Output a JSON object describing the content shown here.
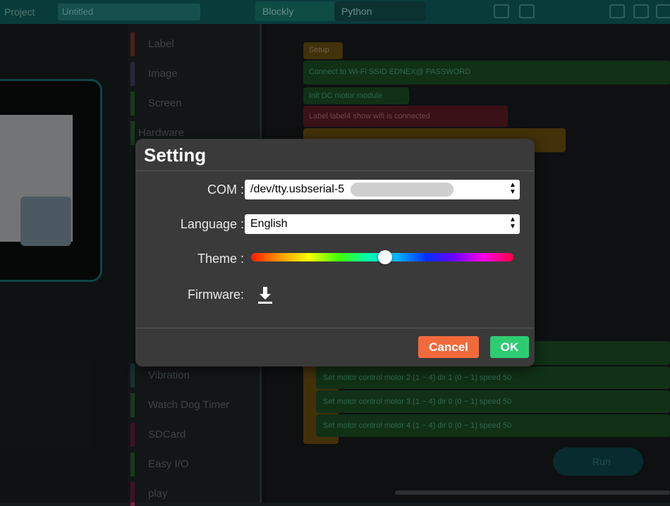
{
  "topbar": {
    "project_label": "Project",
    "project_name": "Untitled",
    "tabs": [
      {
        "label": "Blockly"
      },
      {
        "label": "Python"
      }
    ]
  },
  "categories": [
    {
      "label": "Label",
      "color": "#8a3a2a"
    },
    {
      "label": "Image",
      "color": "#4a4a6a"
    },
    {
      "label": "Screen",
      "color": "#2f6a2f"
    },
    {
      "label": "Hardware",
      "color": "#2f6a2f"
    },
    {
      "label": "Vibration",
      "color": "#2a5a5a"
    },
    {
      "label": "Watch Dog Timer",
      "color": "#2f6a2f"
    },
    {
      "label": "SDCard",
      "color": "#7a2040"
    },
    {
      "label": "Easy I/O",
      "color": "#2f6a2f"
    },
    {
      "label": "play",
      "color": "#7a2040"
    }
  ],
  "workspace": {
    "blocks": [
      {
        "text": "Setup"
      },
      {
        "text": "Connect to Wi-Fi SSID  EDNEX@  PASSWORD"
      },
      {
        "text": "Init DC motor module"
      },
      {
        "text": "Label  label4  show  wifi is connected"
      },
      {
        "text": "Set motor control motor  2  (1 ~ 4) dir  1  (0 ~ 1) speed  50"
      },
      {
        "text": "Set motor control motor  3  (1 ~ 4) dir  0  (0 ~ 1) speed  50"
      },
      {
        "text": "Set motor control motor  4  (1 ~ 4) dir  0  (0 ~ 1) speed  50"
      }
    ],
    "run_label": "Run"
  },
  "dialog": {
    "title": "Setting",
    "com": {
      "label": "COM :",
      "value": "/dev/tty.usbserial-5"
    },
    "language": {
      "label": "Language :",
      "value": "English"
    },
    "theme": {
      "label": "Theme :",
      "value": 0.51
    },
    "firmware": {
      "label": "Firmware:",
      "icon": "download-icon"
    },
    "cancel_label": "Cancel",
    "ok_label": "OK",
    "colors": {
      "cancel": "#f26a3c",
      "ok": "#2ecc71",
      "dialog_bg": "#3a3a3a"
    }
  }
}
